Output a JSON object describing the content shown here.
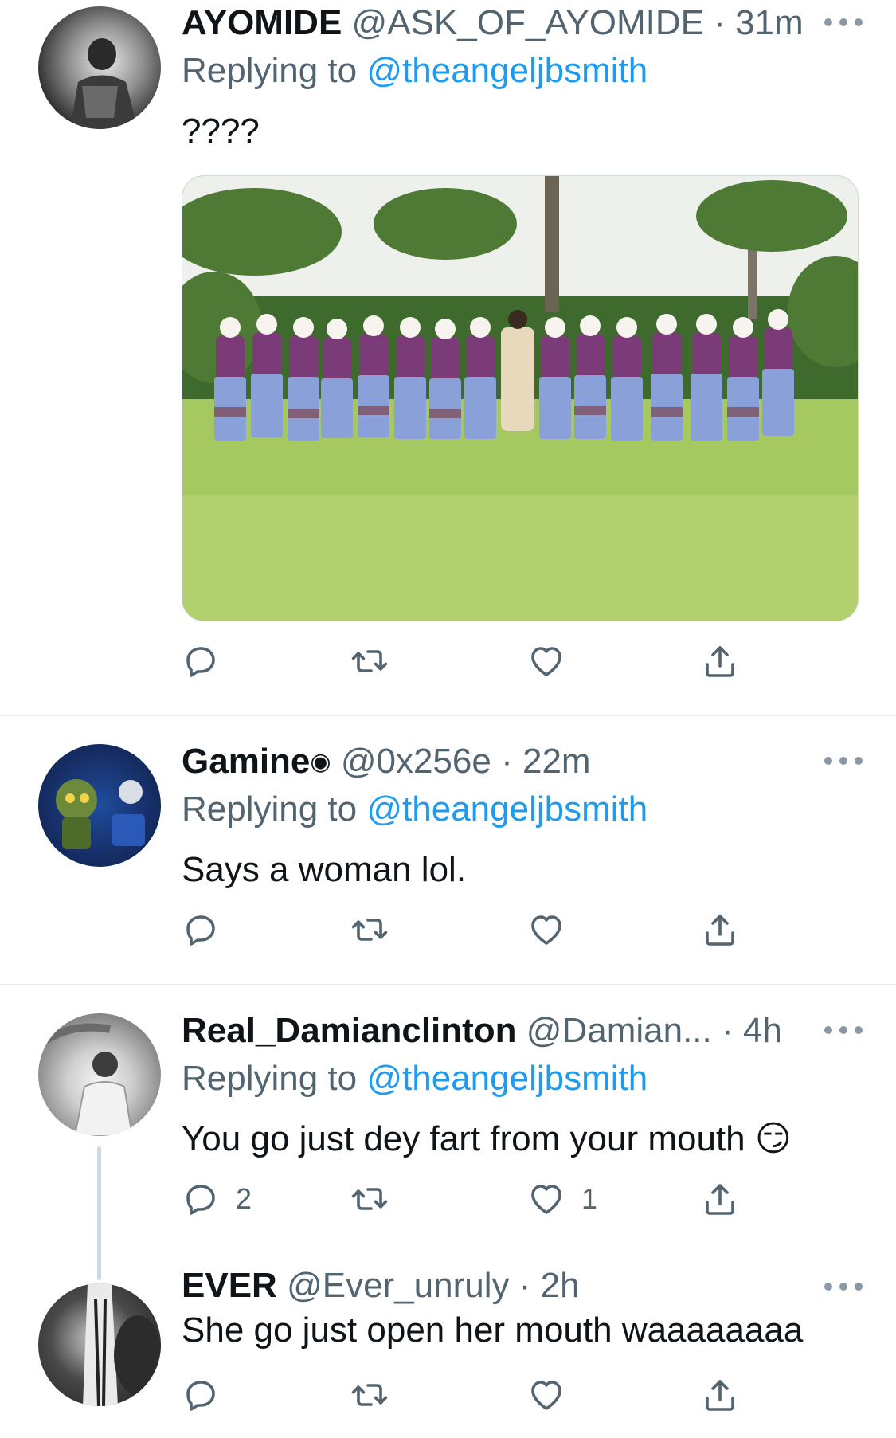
{
  "tweets": [
    {
      "name": "AYOMIDE",
      "handle": "@ASK_OF_AYOMIDE",
      "time": "31m",
      "replying_label": "Replying to",
      "replying_to": "@theangeljbsmith",
      "text": "????",
      "has_image": true,
      "reply_count": "",
      "like_count": ""
    },
    {
      "name": "Gamine",
      "name_badge": "◉",
      "handle": "@0x256e",
      "time": "22m",
      "replying_label": "Replying to",
      "replying_to": "@theangeljbsmith",
      "text": "Says a woman lol.",
      "reply_count": "",
      "like_count": ""
    },
    {
      "name": "Real_Damianclinton",
      "handle": "@Damian...",
      "time": "4h",
      "replying_label": "Replying to",
      "replying_to": "@theangeljbsmith",
      "text": "You go just dey fart from your mouth 😏",
      "reply_count": "2",
      "like_count": "1"
    },
    {
      "name": "EVER",
      "handle": "@Ever_unruly",
      "time": "2h",
      "text": "She go just open her mouth waaaaaaaa",
      "reply_count": "",
      "like_count": ""
    }
  ],
  "separator": "·",
  "icons": {
    "reply": "reply-icon",
    "retweet": "retweet-icon",
    "like": "heart-icon",
    "share": "share-icon",
    "more": "more-icon"
  },
  "colors": {
    "link": "#1d9bf0",
    "secondary": "#536471",
    "icon": "#536471"
  }
}
